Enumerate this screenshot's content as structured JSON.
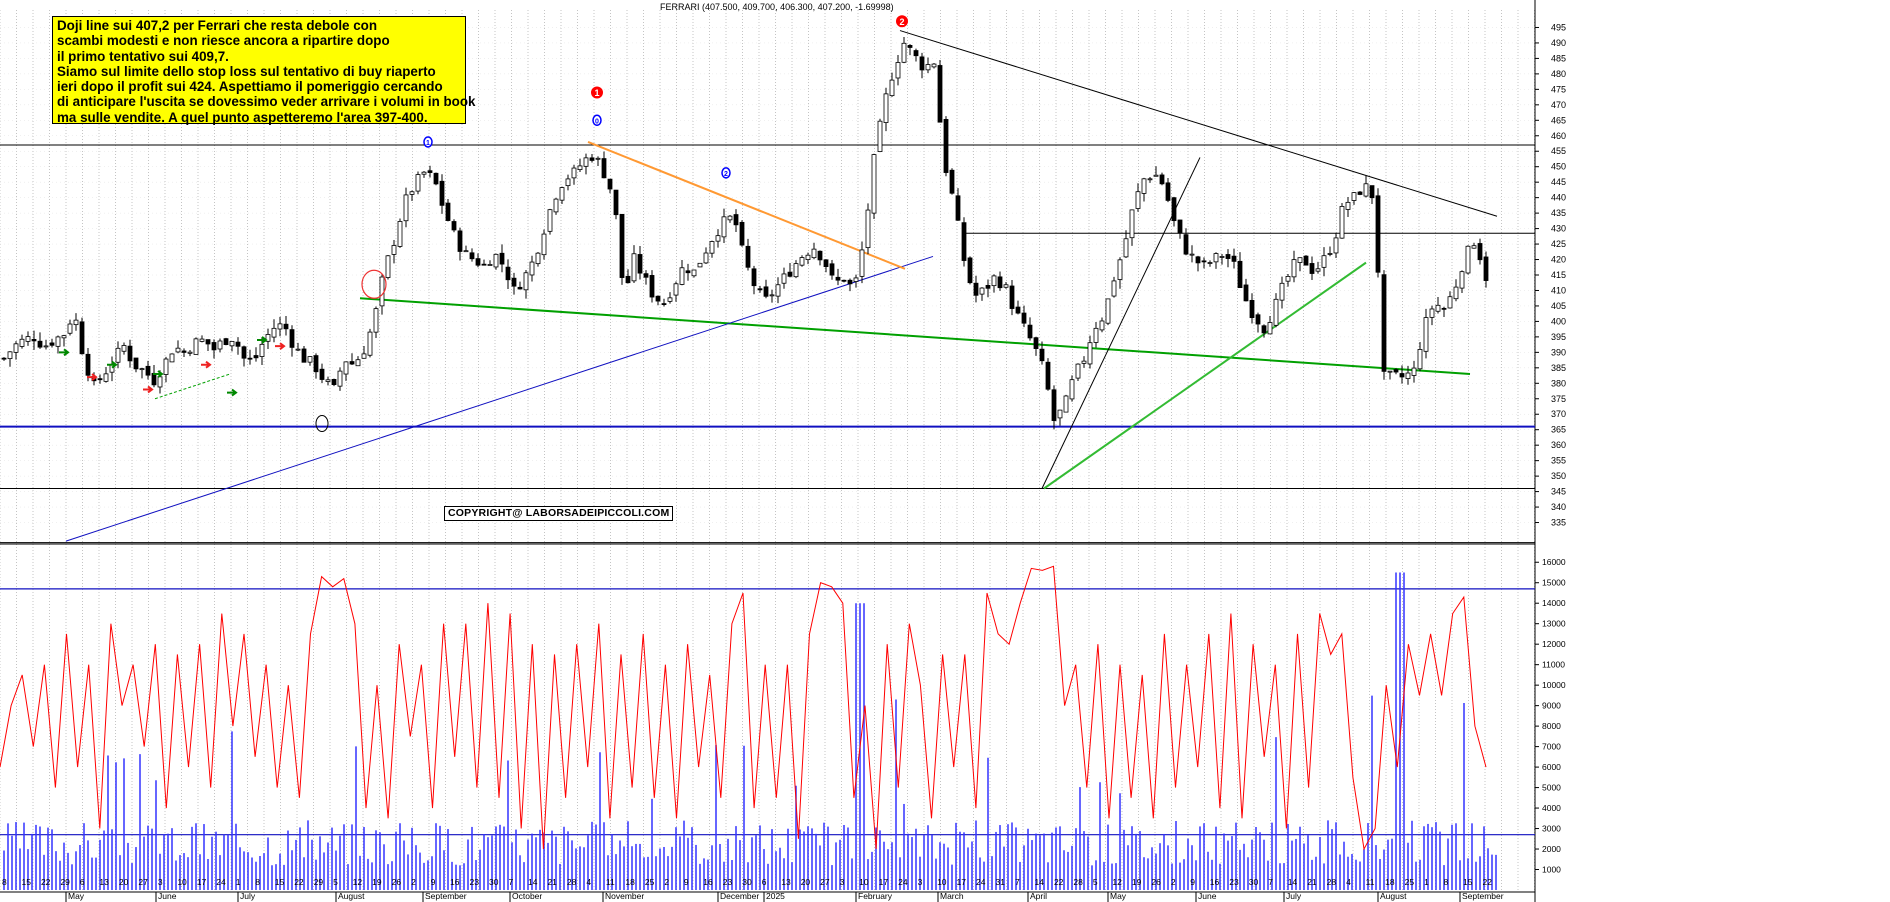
{
  "title": "FERRARI (407.500, 409.700, 406.300, 407.200, -1.69998)",
  "note_lines": [
    "Doji line sui 407,2 per Ferrari che resta debole con",
    "scambi modesti e non riesce ancora a ripartire dopo",
    "il primo tentativo sui 409,7.",
    "Siamo sul limite dello stop loss sul tentativo di buy riaperto",
    "ieri dopo il profit  sui 424. Aspettiamo il pomeriggio  cercando",
    "di anticipare l'uscita se dovessimo veder arrivare i volumi in book",
    "ma sulle vendite. A quel punto aspetteremo l'area 397-400."
  ],
  "copyright": "COPYRIGHT@ LABORSADEIPICCOLI.COM",
  "colors": {
    "candle": "#000000",
    "green_line": "#00a000",
    "blue_line": "#1010c0",
    "orange_line": "#ff9933",
    "black_line": "#000000",
    "volume_bars": "#3333ff",
    "oscillator": "#ff0000",
    "marker_red": "#ff0000",
    "marker_blue": "#0000ff",
    "note_bg": "#ffff00"
  },
  "chart_data": [
    {
      "type": "candlestick",
      "title": "FERRARI (407.500, 409.700, 406.300, 407.200, -1.69998)",
      "ylim": [
        330,
        500
      ],
      "y_ticks": [
        335,
        340,
        345,
        350,
        355,
        360,
        365,
        370,
        375,
        380,
        385,
        390,
        395,
        400,
        405,
        410,
        415,
        420,
        425,
        430,
        435,
        440,
        445,
        450,
        455,
        460,
        465,
        470,
        475,
        480,
        485,
        490,
        495
      ],
      "y_tick_labels": [
        "335",
        "340",
        "345",
        "350",
        "355",
        "360",
        "365",
        "370",
        "375",
        "380",
        "385",
        "390",
        "395",
        "400",
        "405",
        "410",
        "415",
        "420",
        "425",
        "430",
        "435",
        "440",
        "445",
        "450",
        "455",
        "460",
        "465",
        "470",
        "475",
        "480",
        "485",
        "490",
        "495"
      ],
      "x_tick_labels": [
        "8",
        "15",
        "22",
        "29",
        "6",
        "13",
        "20",
        "27",
        "3",
        "10",
        "17",
        "24",
        "1",
        "8",
        "15",
        "22",
        "29",
        "5",
        "12",
        "19",
        "26",
        "2",
        "9",
        "16",
        "23",
        "30",
        "7",
        "14",
        "21",
        "28",
        "4",
        "11",
        "18",
        "25",
        "2",
        "9",
        "16",
        "23",
        "30",
        "6",
        "13",
        "20",
        "27",
        "3",
        "10",
        "17",
        "24",
        "3",
        "10",
        "17",
        "24",
        "31",
        "7",
        "14",
        "22",
        "28",
        "5",
        "12",
        "19",
        "26",
        "2",
        "9",
        "16",
        "23",
        "30",
        "7",
        "14",
        "21",
        "28",
        "4",
        "11",
        "18",
        "25",
        "1",
        "8",
        "15",
        "22"
      ],
      "month_labels": [
        "May",
        "June",
        "July",
        "August",
        "September",
        "October",
        "November",
        "December",
        "2025",
        "February",
        "March",
        "April",
        "May",
        "June",
        "July",
        "August",
        "September"
      ],
      "horizontal_levels": [
        457,
        428.5,
        366,
        346,
        328.5
      ],
      "price_path": [
        [
          0,
          388
        ],
        [
          10,
          392
        ],
        [
          20,
          394
        ],
        [
          30,
          395
        ],
        [
          40,
          392
        ],
        [
          50,
          394
        ],
        [
          60,
          396
        ],
        [
          70,
          403
        ],
        [
          80,
          388
        ],
        [
          90,
          379
        ],
        [
          100,
          383
        ],
        [
          110,
          388
        ],
        [
          120,
          392
        ],
        [
          130,
          386
        ],
        [
          140,
          384
        ],
        [
          150,
          381
        ],
        [
          160,
          386
        ],
        [
          170,
          392
        ],
        [
          180,
          390
        ],
        [
          190,
          393
        ],
        [
          200,
          394
        ],
        [
          210,
          391
        ],
        [
          220,
          394
        ],
        [
          230,
          395
        ],
        [
          240,
          388
        ],
        [
          250,
          387
        ],
        [
          260,
          394
        ],
        [
          270,
          398
        ],
        [
          280,
          399
        ],
        [
          290,
          392
        ],
        [
          300,
          388
        ],
        [
          310,
          386
        ],
        [
          320,
          381
        ],
        [
          330,
          378
        ],
        [
          340,
          388
        ],
        [
          350,
          386
        ],
        [
          360,
          391
        ],
        [
          370,
          400
        ],
        [
          380,
          416
        ],
        [
          390,
          426
        ],
        [
          400,
          438
        ],
        [
          410,
          444
        ],
        [
          420,
          448
        ],
        [
          430,
          446
        ],
        [
          440,
          436
        ],
        [
          450,
          428
        ],
        [
          460,
          422
        ],
        [
          470,
          420
        ],
        [
          480,
          418
        ],
        [
          490,
          422
        ],
        [
          500,
          418
        ],
        [
          510,
          410
        ],
        [
          520,
          414
        ],
        [
          530,
          420
        ],
        [
          540,
          430
        ],
        [
          550,
          440
        ],
        [
          560,
          446
        ],
        [
          570,
          448
        ],
        [
          580,
          452
        ],
        [
          590,
          454
        ],
        [
          600,
          448
        ],
        [
          610,
          440
        ],
        [
          620,
          408
        ],
        [
          630,
          420
        ],
        [
          640,
          414
        ],
        [
          650,
          408
        ],
        [
          660,
          406
        ],
        [
          670,
          412
        ],
        [
          680,
          418
        ],
        [
          690,
          416
        ],
        [
          700,
          422
        ],
        [
          710,
          428
        ],
        [
          720,
          432
        ],
        [
          730,
          434
        ],
        [
          740,
          420
        ],
        [
          750,
          412
        ],
        [
          760,
          406
        ],
        [
          770,
          410
        ],
        [
          780,
          414
        ],
        [
          790,
          418
        ],
        [
          800,
          422
        ],
        [
          810,
          424
        ],
        [
          820,
          420
        ],
        [
          830,
          412
        ],
        [
          840,
          414
        ],
        [
          850,
          410
        ],
        [
          860,
          426
        ],
        [
          870,
          452
        ],
        [
          880,
          470
        ],
        [
          890,
          482
        ],
        [
          900,
          490
        ],
        [
          910,
          486
        ],
        [
          920,
          482
        ],
        [
          930,
          484
        ],
        [
          940,
          452
        ],
        [
          950,
          438
        ],
        [
          960,
          420
        ],
        [
          970,
          408
        ],
        [
          980,
          410
        ],
        [
          990,
          414
        ],
        [
          1000,
          412
        ],
        [
          1010,
          404
        ],
        [
          1020,
          398
        ],
        [
          1030,
          392
        ],
        [
          1040,
          384
        ],
        [
          1050,
          368
        ],
        [
          1060,
          372
        ],
        [
          1070,
          382
        ],
        [
          1080,
          388
        ],
        [
          1090,
          398
        ],
        [
          1100,
          402
        ],
        [
          1110,
          414
        ],
        [
          1120,
          424
        ],
        [
          1130,
          438
        ],
        [
          1140,
          446
        ],
        [
          1150,
          448
        ],
        [
          1160,
          444
        ],
        [
          1170,
          432
        ],
        [
          1180,
          424
        ],
        [
          1190,
          420
        ],
        [
          1200,
          418
        ],
        [
          1210,
          420
        ],
        [
          1220,
          422
        ],
        [
          1230,
          418
        ],
        [
          1240,
          408
        ],
        [
          1250,
          402
        ],
        [
          1260,
          398
        ],
        [
          1270,
          404
        ],
        [
          1280,
          412
        ],
        [
          1290,
          418
        ],
        [
          1300,
          420
        ],
        [
          1310,
          416
        ],
        [
          1320,
          420
        ],
        [
          1330,
          426
        ],
        [
          1340,
          438
        ],
        [
          1350,
          440
        ],
        [
          1360,
          444
        ],
        [
          1370,
          440
        ],
        [
          1380,
          382
        ],
        [
          1390,
          382
        ],
        [
          1400,
          382
        ],
        [
          1410,
          384
        ],
        [
          1420,
          398
        ],
        [
          1430,
          406
        ],
        [
          1440,
          404
        ],
        [
          1450,
          410
        ],
        [
          1460,
          420
        ],
        [
          1470,
          426
        ],
        [
          1480,
          418
        ],
        [
          1486,
          407.2
        ]
      ],
      "annotations": [
        {
          "label": "1",
          "color": "red",
          "x": 597,
          "y": 474
        },
        {
          "label": "0",
          "color": "blue",
          "x": 597,
          "y": 465
        },
        {
          "label": "1",
          "color": "blue",
          "x": 428,
          "y": 458
        },
        {
          "label": "2",
          "color": "blue",
          "x": 726,
          "y": 448
        },
        {
          "label": "2",
          "color": "red",
          "x": 902,
          "y": 497
        }
      ]
    },
    {
      "type": "line",
      "title": "",
      "ylim": [
        0,
        16500
      ],
      "y_ticks": [
        1000,
        2000,
        3000,
        4000,
        5000,
        6000,
        7000,
        8000,
        9000,
        10000,
        11000,
        12000,
        13000,
        14000,
        15000,
        16000
      ],
      "y_tick_labels": [
        "1000",
        "2000",
        "3000",
        "4000",
        "5000",
        "6000",
        "7000",
        "8000",
        "9000",
        "10000",
        "11000",
        "12000",
        "13000",
        "14000",
        "15000",
        "16000"
      ],
      "horizontal_levels": [
        14700,
        2700
      ],
      "series": [
        {
          "values_note": "",
          "oscillator": [
            6000,
            9000,
            10500,
            7000,
            11000,
            5000,
            12500,
            6000,
            11000,
            3000,
            13000,
            9000,
            11000,
            7000,
            12000,
            4000,
            11500,
            6000,
            12000,
            5000,
            13500,
            8000,
            12500,
            6500,
            11000,
            5000,
            10000,
            4500,
            12500,
            15300,
            14800,
            15200,
            13000,
            4000,
            10000,
            3500,
            12000,
            7500,
            11000,
            4000,
            13000,
            6500,
            13000,
            5000,
            14000,
            4500,
            13500,
            3000,
            12000,
            2000,
            11500,
            4500,
            12000,
            6000,
            13000,
            3500,
            11500,
            5000,
            12500,
            4500,
            11000,
            3500,
            12000,
            6000,
            10500,
            4500,
            13000,
            14500,
            4000,
            11000,
            4500,
            11000,
            2500,
            12500,
            15000,
            14800,
            14000,
            4500,
            9000,
            2000,
            12000,
            5000,
            13000,
            10000,
            3500,
            11500,
            6000,
            11500,
            4000,
            14500,
            12500,
            12000,
            14000,
            15700,
            15600,
            15800,
            9000,
            11000,
            5000,
            12000,
            3500,
            11000,
            4500,
            10500,
            3500,
            12500,
            5000,
            11000,
            6000,
            12500,
            4000,
            13500,
            3500,
            12000,
            6500,
            11000,
            3000,
            12500,
            5000,
            13500,
            11500,
            12500,
            5500,
            2000,
            3000,
            10000,
            6000,
            12000,
            9500,
            12500,
            9500,
            13500,
            14300,
            8000,
            6000
          ]
        }
      ]
    }
  ]
}
